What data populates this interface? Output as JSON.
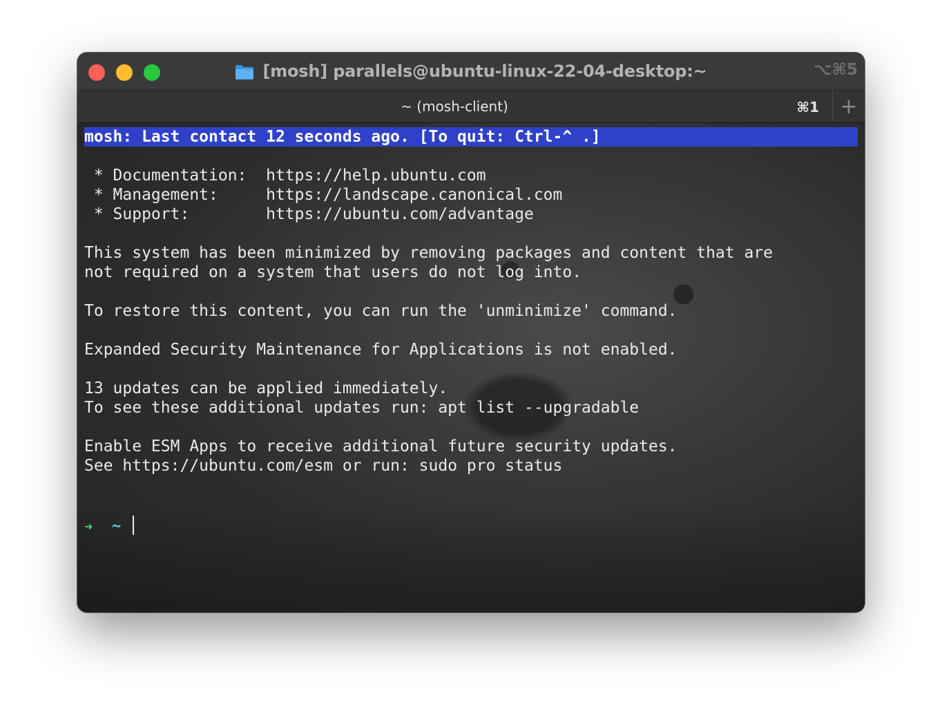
{
  "window": {
    "title": "[mosh] parallels@ubuntu-linux-22-04-desktop:~",
    "shortcut": "⌥⌘5"
  },
  "tab": {
    "label": "~ (mosh-client)",
    "shortcut": "⌘1",
    "new_tab_label": "+"
  },
  "terminal": {
    "status_line": "mosh: Last contact 12 seconds ago. [To quit: Ctrl-^ .]",
    "lines": [
      " * Documentation:  https://help.ubuntu.com",
      " * Management:     https://landscape.canonical.com",
      " * Support:        https://ubuntu.com/advantage",
      "This system has been minimized by removing packages and content that are",
      "not required on a system that users do not log into.",
      "To restore this content, you can run the 'unminimize' command.",
      "Expanded Security Maintenance for Applications is not enabled.",
      "13 updates can be applied immediately.",
      "To see these additional updates run: apt list --upgradable",
      "Enable ESM Apps to receive additional future security updates.",
      "See https://ubuntu.com/esm or run: sudo pro status"
    ],
    "prompt_arrow": "➜",
    "prompt_dir": "~"
  },
  "colors": {
    "status_bar_bg": "#2f41c9",
    "prompt_arrow": "#4cd964",
    "prompt_dir": "#5ad4e6",
    "close_button": "#ff5f57",
    "minimize_button": "#febc2e",
    "zoom_button": "#28c840",
    "folder_icon": "#5ab0f0"
  },
  "icons": {
    "title_icon": "folder-icon"
  }
}
